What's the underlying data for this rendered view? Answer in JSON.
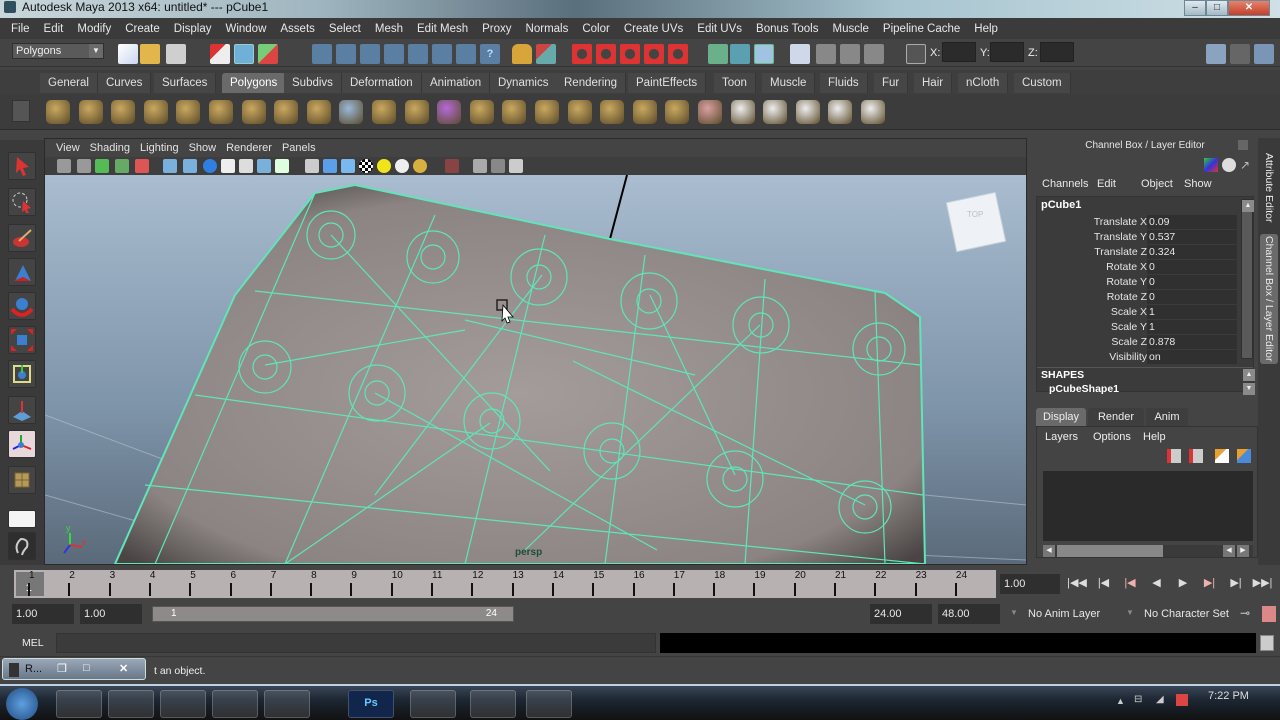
{
  "window": {
    "title": "Autodesk Maya 2013 x64: untitled*   ---   pCube1",
    "minimize": "–",
    "maximize": "□",
    "close": "✕"
  },
  "menubar": [
    "File",
    "Edit",
    "Modify",
    "Create",
    "Display",
    "Window",
    "Assets",
    "Select",
    "Mesh",
    "Edit Mesh",
    "Proxy",
    "Normals",
    "Color",
    "Create UVs",
    "Edit UVs",
    "Bonus Tools",
    "Muscle",
    "Pipeline Cache",
    "Help"
  ],
  "statusline": {
    "mode": "Polygons",
    "x_label": "X:",
    "y_label": "Y:",
    "z_label": "Z:",
    "x_value": "",
    "y_value": "",
    "z_value": ""
  },
  "shelf_tabs": [
    {
      "label": "General",
      "active": false
    },
    {
      "label": "Curves",
      "active": false
    },
    {
      "label": "Surfaces",
      "active": false
    },
    {
      "label": "Polygons",
      "active": true
    },
    {
      "label": "Subdivs",
      "active": false
    },
    {
      "label": "Deformation",
      "active": false
    },
    {
      "label": "Animation",
      "active": false
    },
    {
      "label": "Dynamics",
      "active": false
    },
    {
      "label": "Rendering",
      "active": false
    },
    {
      "label": "PaintEffects",
      "active": false
    },
    {
      "label": "Toon",
      "active": false
    },
    {
      "label": "Muscle",
      "active": false
    },
    {
      "label": "Fluids",
      "active": false
    },
    {
      "label": "Fur",
      "active": false
    },
    {
      "label": "Hair",
      "active": false
    },
    {
      "label": "nCloth",
      "active": false
    },
    {
      "label": "Custom",
      "active": false
    }
  ],
  "shelf_icons": [
    "poly-sphere-icon",
    "poly-cube-icon",
    "poly-cylinder-icon",
    "poly-cone-icon",
    "poly-plane-icon",
    "poly-torus-icon",
    "poly-pyramid-icon",
    "poly-pipe-icon",
    "poly-platonic-icon",
    "separate-icon",
    "combine-icon",
    "smooth-icon",
    "cube-purple-icon",
    "extrude-icon",
    "bridge-icon",
    "append-icon",
    "split-icon",
    "bevel-icon",
    "merge-icon",
    "wedge-icon",
    "poke-icon",
    "planar-map-icon",
    "cylindrical-map-icon",
    "spherical-map-icon",
    "automatic-map-icon",
    "uv-editor-icon"
  ],
  "viewport": {
    "menu": [
      "View",
      "Shading",
      "Lighting",
      "Show",
      "Renderer",
      "Panels"
    ],
    "camera_label": "persp",
    "viewcube_label": "TOP",
    "axis": {
      "x": "x",
      "y": "y",
      "z": "z"
    }
  },
  "channel_box": {
    "title": "Channel Box / Layer Editor",
    "menu": [
      "Channels",
      "Edit",
      "Object",
      "Show"
    ],
    "object": "pCube1",
    "channels": [
      {
        "label": "Translate X",
        "value": "0.09"
      },
      {
        "label": "Translate Y",
        "value": "0.537"
      },
      {
        "label": "Translate Z",
        "value": "0.324"
      },
      {
        "label": "Rotate X",
        "value": "0"
      },
      {
        "label": "Rotate Y",
        "value": "0"
      },
      {
        "label": "Rotate Z",
        "value": "0"
      },
      {
        "label": "Scale X",
        "value": "1"
      },
      {
        "label": "Scale Y",
        "value": "1"
      },
      {
        "label": "Scale Z",
        "value": "0.878"
      },
      {
        "label": "Visibility",
        "value": "on"
      }
    ],
    "shapes_header": "SHAPES",
    "shape": "pCubeShape1",
    "layer_tabs": [
      "Display",
      "Render",
      "Anim"
    ],
    "layer_menu": [
      "Layers",
      "Options",
      "Help"
    ]
  },
  "side_tabs": [
    "Attribute Editor",
    "Channel Box / Layer Editor"
  ],
  "timeline": {
    "ticks": [
      "1",
      "2",
      "3",
      "4",
      "5",
      "6",
      "7",
      "8",
      "9",
      "10",
      "11",
      "12",
      "13",
      "14",
      "15",
      "16",
      "17",
      "18",
      "19",
      "20",
      "21",
      "22",
      "23",
      "24"
    ],
    "current_frame": "1",
    "current_time": "1.00",
    "playback": [
      "go-to-start",
      "step-back-key",
      "step-back-frame",
      "play-backward",
      "play-forward",
      "step-forward-frame",
      "step-forward-key",
      "go-to-end"
    ]
  },
  "range": {
    "start_time": "1.00",
    "playback_start": "1.00",
    "slider_start": "1",
    "slider_end": "24",
    "playback_end": "24.00",
    "end_time": "48.00",
    "anim_layer": "No Anim Layer",
    "character_set": "No Character Set"
  },
  "command_line": {
    "label": "MEL",
    "value": ""
  },
  "help_line": {
    "text": "t an object."
  },
  "floating_window": {
    "label": "R..."
  },
  "taskbar": {
    "clock": "7:22 PM"
  }
}
